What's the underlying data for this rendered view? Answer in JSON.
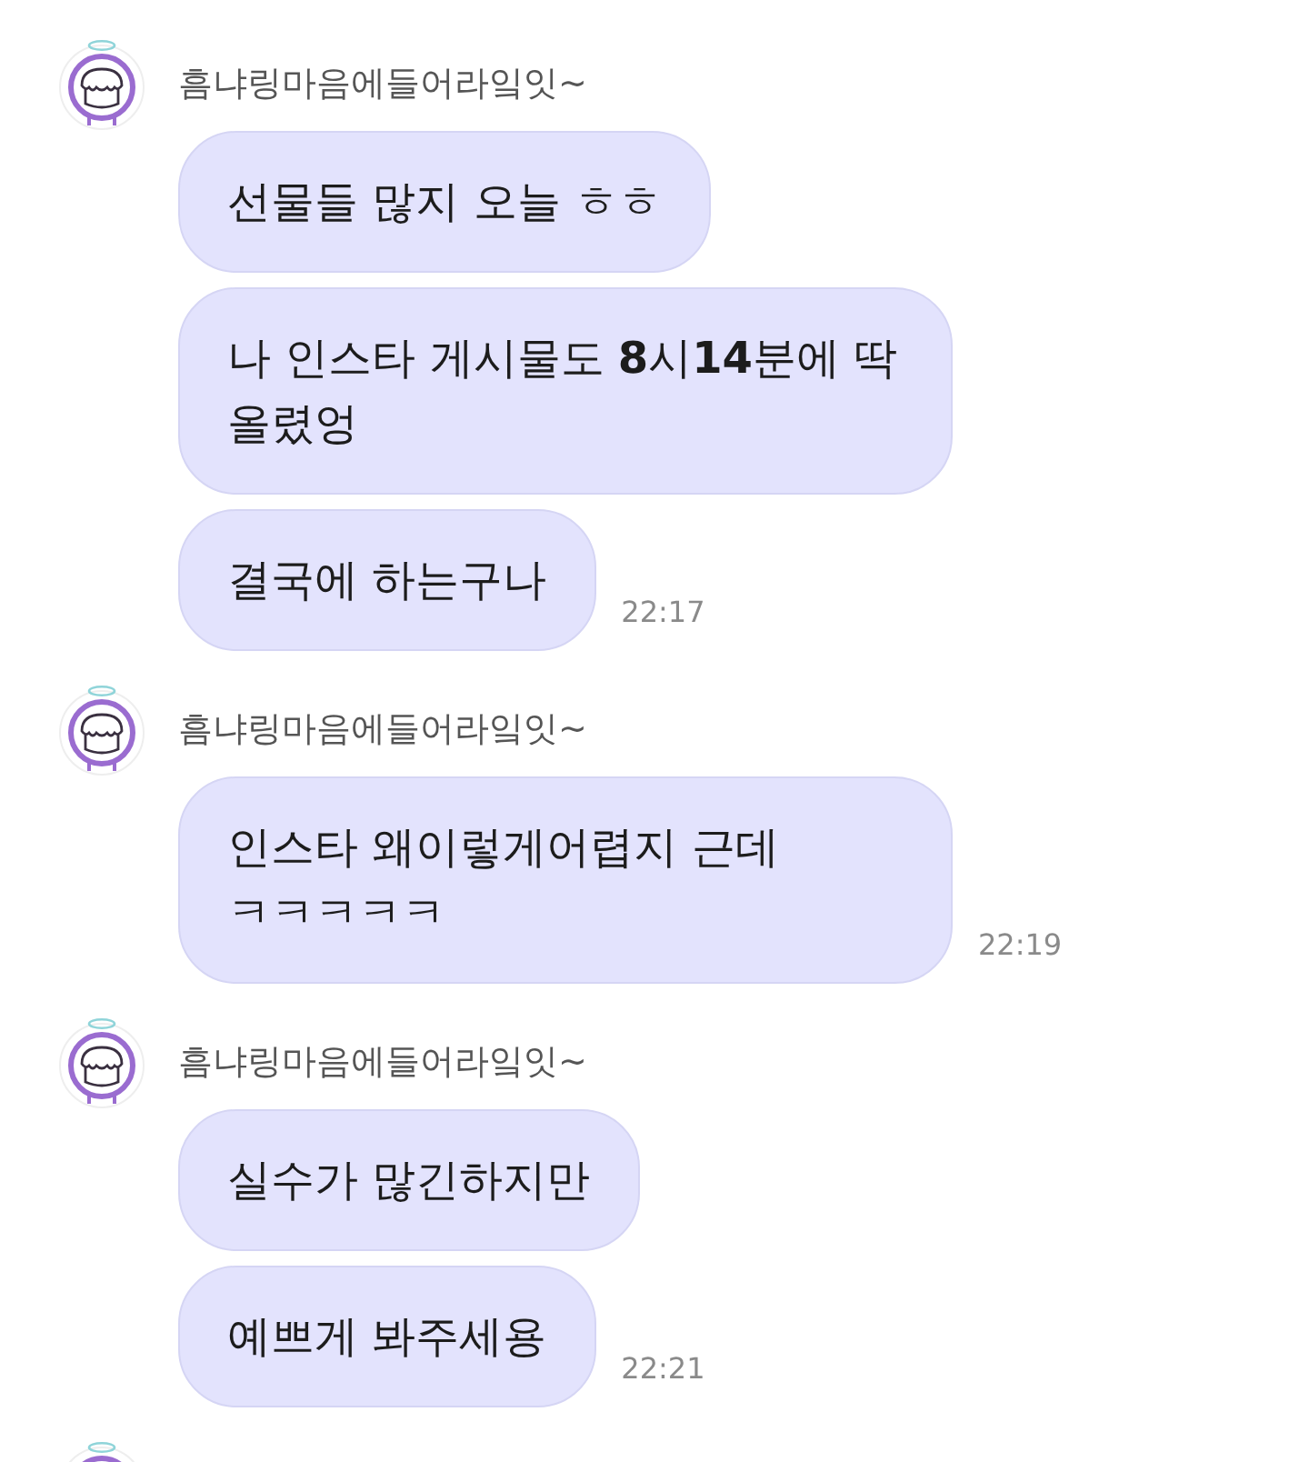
{
  "groups": [
    {
      "avatar": true,
      "sender": "흠냐링마음에들어라잌잇~",
      "messages": [
        {
          "text": "선물들 많지 오늘 ㅎㅎ"
        },
        {
          "text": "나 인스타 게시물도 **8**시**14**분에 딱 올렸엉"
        },
        {
          "text": "결국에 하는구나",
          "time": "22:17"
        }
      ]
    },
    {
      "avatar": true,
      "sender": "흠냐링마음에들어라잌잇~",
      "messages": [
        {
          "text": "인스타 왜이렇게어렵지 근데 ㅋㅋㅋㅋㅋ",
          "time": "22:19"
        }
      ]
    },
    {
      "avatar": true,
      "sender": "흠냐링마음에들어라잌잇~",
      "messages": [
        {
          "text": "실수가 많긴하지만"
        },
        {
          "text": "예쁘게 봐주세용",
          "time": "22:21"
        }
      ]
    },
    {
      "avatar": true
    }
  ]
}
